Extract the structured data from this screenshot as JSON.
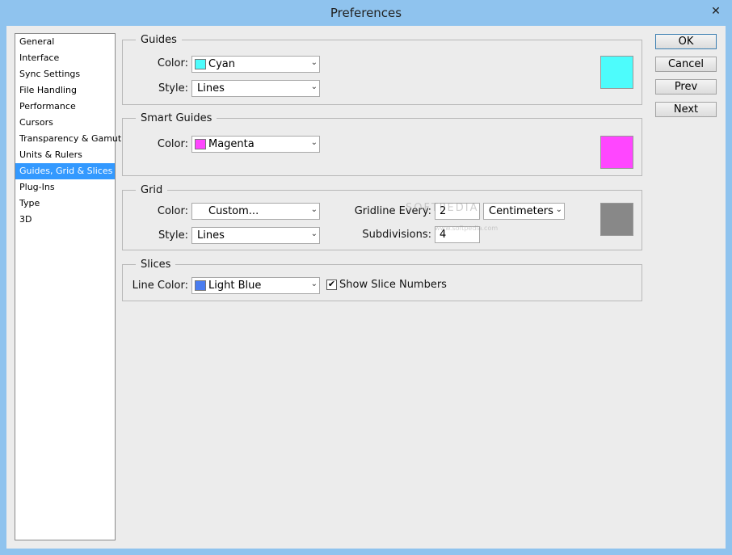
{
  "window": {
    "title": "Preferences",
    "close_glyph": "✕"
  },
  "sidebar": {
    "items": [
      {
        "label": "General"
      },
      {
        "label": "Interface"
      },
      {
        "label": "Sync Settings"
      },
      {
        "label": "File Handling"
      },
      {
        "label": "Performance"
      },
      {
        "label": "Cursors"
      },
      {
        "label": "Transparency & Gamut"
      },
      {
        "label": "Units & Rulers"
      },
      {
        "label": "Guides, Grid & Slices",
        "selected": true
      },
      {
        "label": "Plug-Ins"
      },
      {
        "label": "Type"
      },
      {
        "label": "3D"
      }
    ]
  },
  "guides": {
    "legend": "Guides",
    "color_label": "Color:",
    "color_value": "Cyan",
    "color_hex": "#4dfcfc",
    "style_label": "Style:",
    "style_value": "Lines"
  },
  "smart_guides": {
    "legend": "Smart Guides",
    "color_label": "Color:",
    "color_value": "Magenta",
    "color_hex": "#ff46ff"
  },
  "grid": {
    "legend": "Grid",
    "color_label": "Color:",
    "color_value": "Custom...",
    "color_hex": "#888888",
    "style_label": "Style:",
    "style_value": "Lines",
    "gridline_label": "Gridline Every:",
    "gridline_value": "2",
    "unit_value": "Centimeters",
    "subdivisions_label": "Subdivisions:",
    "subdivisions_value": "4"
  },
  "slices": {
    "legend": "Slices",
    "line_color_label": "Line Color:",
    "line_color_value": "Light Blue",
    "line_color_hex": "#4a7df0",
    "show_numbers_label": "Show Slice Numbers",
    "show_numbers_checked": true,
    "check_glyph": "✔"
  },
  "buttons": {
    "ok": "OK",
    "cancel": "Cancel",
    "prev": "Prev",
    "next": "Next"
  },
  "watermark": {
    "text": "SOFTPEDIA",
    "small": "www.softpedia.com"
  },
  "icons": {
    "dropdown_arrow": "⌄",
    "dropdown_icon": "chevron-down-icon"
  },
  "colors": {
    "selection": "#3399ff",
    "titlebar": "#8fc3ee"
  }
}
